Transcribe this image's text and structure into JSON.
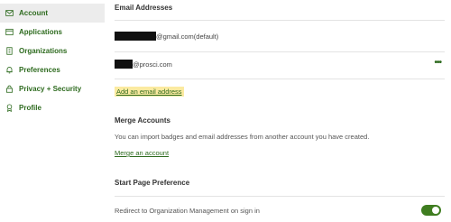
{
  "sidebar": {
    "items": [
      {
        "label": "Account",
        "icon": "mail-icon",
        "active": true
      },
      {
        "label": "Applications",
        "icon": "window-icon"
      },
      {
        "label": "Organizations",
        "icon": "building-icon"
      },
      {
        "label": "Preferences",
        "icon": "bell-icon"
      },
      {
        "label": "Privacy + Security",
        "icon": "lock-icon"
      },
      {
        "label": "Profile",
        "icon": "badge-icon"
      }
    ]
  },
  "main": {
    "email_heading": "Email Addresses",
    "emails": [
      {
        "value": "@gmail.com(default)"
      },
      {
        "value": "@prosci.com",
        "menu_label": "•••"
      }
    ],
    "add_email_label": "Add an email address",
    "merge_heading": "Merge Accounts",
    "merge_description": "You can import badges and email addresses from another account you have created.",
    "merge_link": "Merge an account",
    "start_page_heading": "Start Page Preference",
    "redirect_label": "Redirect to Organization Management on sign in",
    "redirect_enabled": true
  },
  "colors": {
    "accent": "#2e6b1f",
    "toggle_on": "#3f7d20",
    "highlight": "#fbeaa0",
    "sidebar_active_bg": "#ececec"
  }
}
